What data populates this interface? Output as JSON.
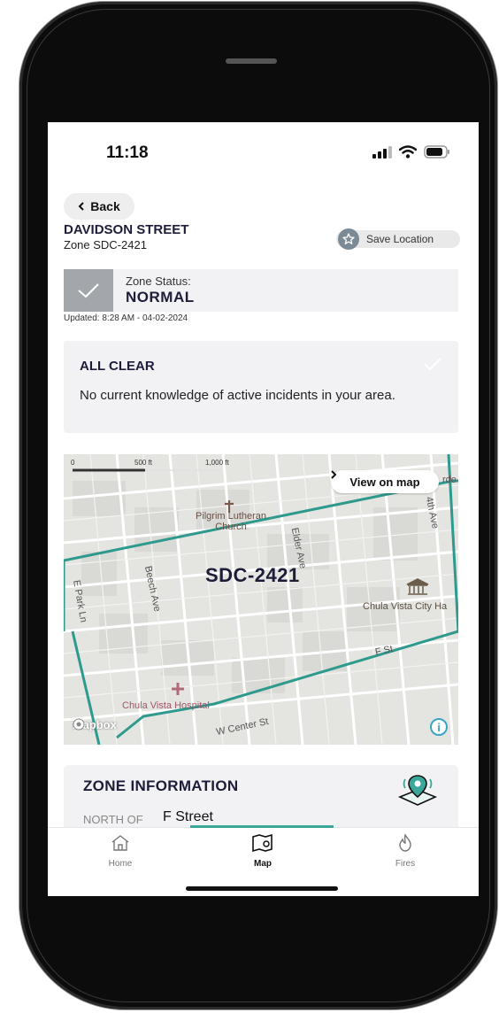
{
  "status_bar": {
    "time": "11:18"
  },
  "header": {
    "back_label": "Back",
    "street": "DAVIDSON STREET",
    "zone": "Zone SDC-2421",
    "save_label": "Save Location"
  },
  "zone_status": {
    "label": "Zone Status:",
    "value": "NORMAL",
    "updated": "Updated: 8:28 AM - 04-02-2024"
  },
  "alert": {
    "title": "ALL CLEAR",
    "message": "No current knowledge of active incidents in your area."
  },
  "map": {
    "view_on_map": "View on map",
    "zone_label": "SDC-2421",
    "scale": {
      "zero": "0",
      "mid": "500 ft",
      "end": "1,000 ft"
    },
    "places": {
      "church": "Pilgrim Lutheran Church",
      "hospital": "Chula Vista Hospital",
      "city_hall": "Chula Vista City Ha"
    },
    "streets": {
      "elder": "Elder Ave",
      "beech": "Beech Ave",
      "epark": "E Park Ln",
      "fst": "F St",
      "wcenter": "W Center St",
      "fourth": "4th Ave",
      "garden": "rde"
    },
    "attribution": "mapbox",
    "zone_outline_color": "#2e9a8e"
  },
  "zone_info": {
    "title": "ZONE INFORMATION",
    "north_key": "NORTH OF",
    "north_value": "F Street"
  },
  "nav": {
    "items": [
      {
        "label": "Home",
        "icon": "home-icon"
      },
      {
        "label": "Map",
        "icon": "map-icon"
      },
      {
        "label": "Fires",
        "icon": "fire-icon"
      }
    ],
    "active_color": "#3aa79a"
  }
}
